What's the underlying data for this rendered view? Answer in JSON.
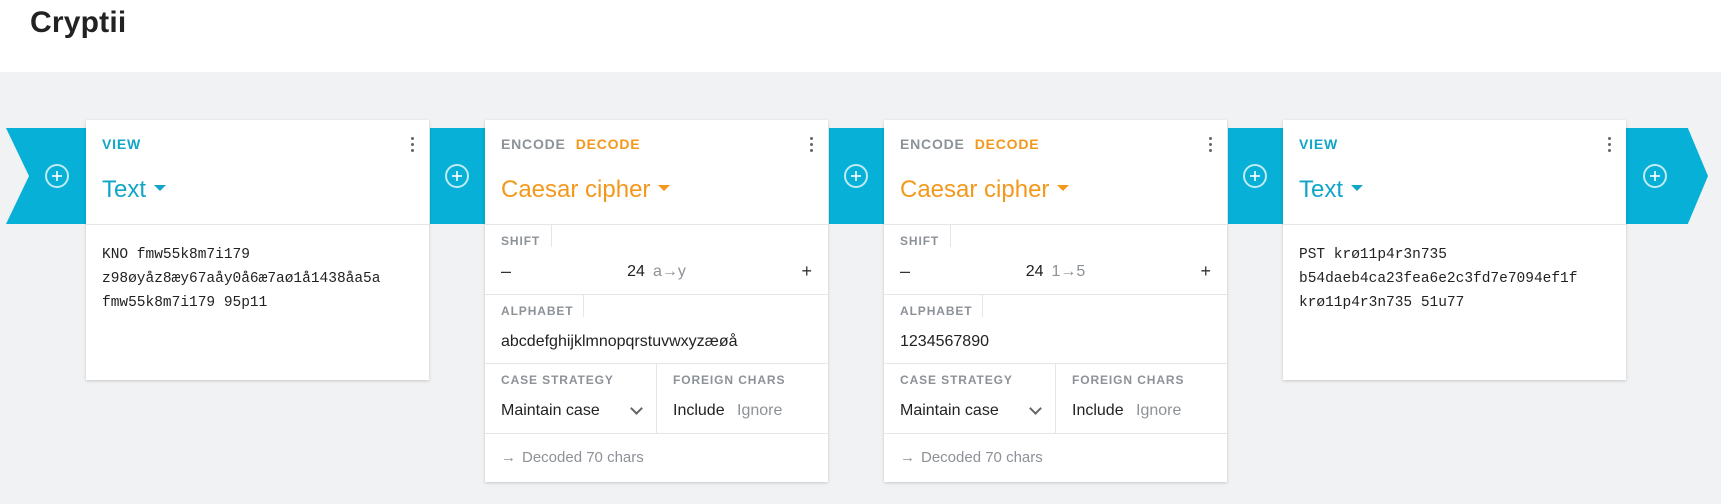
{
  "app": {
    "title": "Cryptii"
  },
  "pipeline": [
    {
      "type": "view",
      "label": "VIEW",
      "title": "Text",
      "content_lines": [
        "KNO fmw55k8m7i179",
        "z98øyåz8æy67aåy0å6æ7aø1å1438åa5a",
        "fmw55k8m7i179 95p11"
      ]
    },
    {
      "type": "encoder",
      "encode_label": "ENCODE",
      "decode_label": "DECODE",
      "title": "Caesar cipher",
      "shift_label": "SHIFT",
      "shift_value": "24",
      "shift_mapping": "a→y",
      "alphabet_label": "ALPHABET",
      "alphabet_value": "abcdefghijklmnopqrstuvwxyzæøå",
      "case_label": "CASE STRATEGY",
      "case_value": "Maintain case",
      "foreign_label": "FOREIGN CHARS",
      "foreign_include": "Include",
      "foreign_ignore": "Ignore",
      "status": "Decoded 70 chars"
    },
    {
      "type": "encoder",
      "encode_label": "ENCODE",
      "decode_label": "DECODE",
      "title": "Caesar cipher",
      "shift_label": "SHIFT",
      "shift_value": "24",
      "shift_mapping": "1→5",
      "alphabet_label": "ALPHABET",
      "alphabet_value": "1234567890",
      "case_label": "CASE STRATEGY",
      "case_value": "Maintain case",
      "foreign_label": "FOREIGN CHARS",
      "foreign_include": "Include",
      "foreign_ignore": "Ignore",
      "status": "Decoded 70 chars"
    },
    {
      "type": "view",
      "label": "VIEW",
      "title": "Text",
      "content_lines": [
        "PST krø11p4r3n735",
        "b54daeb4ca23fea6e2c3fd7e7094ef1f",
        "krø11p4r3n735 51u77"
      ]
    }
  ],
  "icons": {
    "add": "plus-circle-icon",
    "menu": "more-vertical-icon",
    "arrow": "arrow-right-icon",
    "caret": "caret-down-icon"
  },
  "colors": {
    "pipe": "#06b0d6",
    "view_accent": "#11a5c8",
    "decode_accent": "#f4981c",
    "muted": "#8d9298"
  }
}
